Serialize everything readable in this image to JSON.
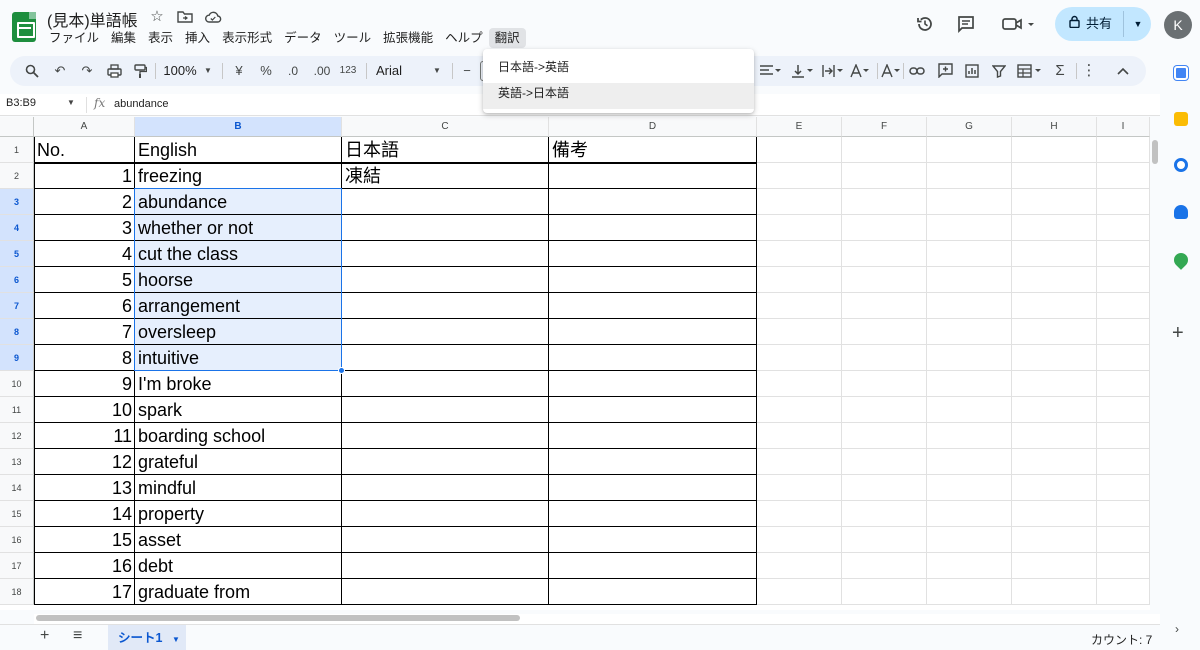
{
  "header": {
    "title": "(見本)単語帳",
    "title_icons": [
      "star-icon",
      "move-folder-icon",
      "cloud-saved-icon"
    ],
    "menu": [
      "ファイル",
      "編集",
      "表示",
      "挿入",
      "表示形式",
      "データ",
      "ツール",
      "拡張機能",
      "ヘルプ",
      "翻訳"
    ],
    "active_menu_index": 9,
    "right_icons": [
      "history-icon",
      "comment-icon",
      "meet-icon"
    ],
    "share_label": "共有",
    "avatar_initial": "K"
  },
  "toolbar": {
    "zoom": "100%",
    "currency": "¥",
    "percent": "%",
    "decrease_decimals": ".0",
    "increase_decimals": ".00",
    "number_format": "123",
    "font": "Arial",
    "font_size_minus": "−",
    "icons": [
      "search-icon",
      "undo-icon",
      "redo-icon",
      "print-icon",
      "paint-format-icon",
      "align-icon",
      "valign-icon",
      "wrap-icon",
      "rotate-icon",
      "link-icon",
      "comment-icon",
      "chart-icon",
      "filter-icon",
      "table-view-icon",
      "function-icon",
      "more-icon",
      "collapse-icon"
    ]
  },
  "formula_bar": {
    "name_box": "B3:B9",
    "fx": "fx",
    "value": "abundance"
  },
  "columns": [
    "A",
    "B",
    "C",
    "D",
    "E",
    "F",
    "G",
    "H",
    "I"
  ],
  "rows": [
    "1",
    "2",
    "3",
    "4",
    "5",
    "6",
    "7",
    "8",
    "9",
    "10",
    "11",
    "12",
    "13",
    "14",
    "15",
    "16",
    "17",
    "18"
  ],
  "headers_row": [
    "No.",
    "English",
    "日本語",
    "備考"
  ],
  "data_rows": [
    {
      "no": "1",
      "english": "freezing",
      "japanese": "凍結",
      "note": ""
    },
    {
      "no": "2",
      "english": "abundance",
      "japanese": "",
      "note": ""
    },
    {
      "no": "3",
      "english": "whether or not",
      "japanese": "",
      "note": ""
    },
    {
      "no": "4",
      "english": "cut the class",
      "japanese": "",
      "note": ""
    },
    {
      "no": "5",
      "english": "hoorse",
      "japanese": "",
      "note": ""
    },
    {
      "no": "6",
      "english": "arrangement",
      "japanese": "",
      "note": ""
    },
    {
      "no": "7",
      "english": "oversleep",
      "japanese": "",
      "note": ""
    },
    {
      "no": "8",
      "english": "intuitive",
      "japanese": "",
      "note": ""
    },
    {
      "no": "9",
      "english": "I'm broke",
      "japanese": "",
      "note": ""
    },
    {
      "no": "10",
      "english": "spark",
      "japanese": "",
      "note": ""
    },
    {
      "no": "11",
      "english": "boarding school",
      "japanese": "",
      "note": ""
    },
    {
      "no": "12",
      "english": "grateful",
      "japanese": "",
      "note": ""
    },
    {
      "no": "13",
      "english": "mindful",
      "japanese": "",
      "note": ""
    },
    {
      "no": "14",
      "english": "property",
      "japanese": "",
      "note": ""
    },
    {
      "no": "15",
      "english": "asset",
      "japanese": "",
      "note": ""
    },
    {
      "no": "16",
      "english": "debt",
      "japanese": "",
      "note": ""
    },
    {
      "no": "17",
      "english": "graduate from",
      "japanese": "",
      "note": ""
    }
  ],
  "dropdown": {
    "items": [
      "日本語->英語",
      "英語->日本語"
    ],
    "hover_index": 1
  },
  "bottom": {
    "sheet_name": "シート1",
    "count_label": "カウント: 7"
  },
  "colors": {
    "accent": "#1a73e8",
    "share_bg": "#c2e7ff",
    "sheets_green": "#1e8e3e"
  }
}
